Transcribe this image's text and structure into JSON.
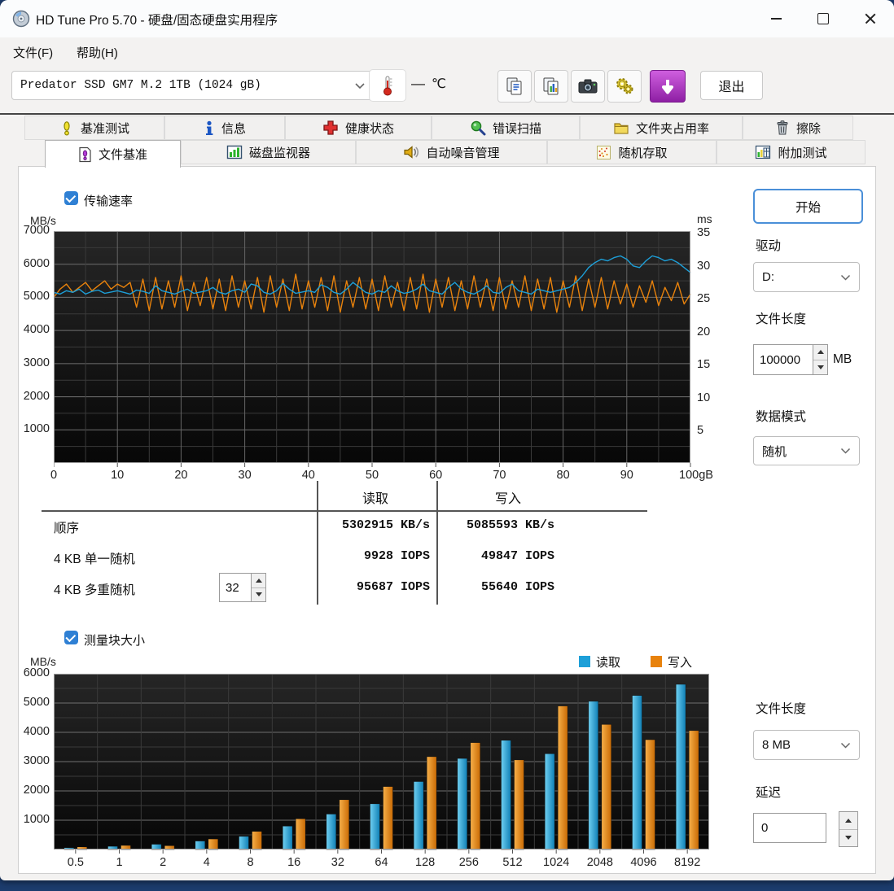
{
  "colors": {
    "accent": "#2f80d4",
    "read": "#1d9fd8",
    "write": "#e8820c",
    "desktop": "#1c3c6d"
  },
  "window": {
    "title": "HD Tune Pro 5.70 - 硬盘/固态硬盘实用程序"
  },
  "menu": {
    "items": [
      {
        "label": "文件(F)"
      },
      {
        "label": "帮助(H)"
      }
    ]
  },
  "toolbar": {
    "drive_select": "Predator SSD GM7 M.2 1TB (1024 gB)",
    "temp_dash": "—",
    "temp_unit": "℃",
    "exit_label": "退出"
  },
  "tabs": {
    "row1": [
      {
        "label": "基准测试"
      },
      {
        "label": "信息"
      },
      {
        "label": "健康状态"
      },
      {
        "label": "错误扫描"
      },
      {
        "label": "文件夹占用率"
      },
      {
        "label": "擦除"
      }
    ],
    "row2": [
      {
        "label": "文件基准"
      },
      {
        "label": "磁盘监视器"
      },
      {
        "label": "自动噪音管理"
      },
      {
        "label": "随机存取"
      },
      {
        "label": "附加测试"
      }
    ],
    "active": "文件基准"
  },
  "transfer_section": {
    "checkbox_label": "传输速率",
    "y_unit": "MB/s",
    "right_unit": "ms"
  },
  "results_table": {
    "col_headers": [
      "读取",
      "写入"
    ],
    "rows": [
      {
        "label": "顺序",
        "read": "5302915 KB/s",
        "write": "5085593 KB/s"
      },
      {
        "label": "4 KB 单一随机",
        "read": "9928 IOPS",
        "write": "49847 IOPS"
      },
      {
        "label": "4 KB 多重随机",
        "queue_depth": "32",
        "read": "95687 IOPS",
        "write": "55640 IOPS"
      }
    ]
  },
  "block_section": {
    "checkbox_label": "测量块大小",
    "y_unit": "MB/s",
    "legend": [
      {
        "label": "读取",
        "color": "#1d9fd8"
      },
      {
        "label": "写入",
        "color": "#e8820c"
      }
    ]
  },
  "controls_right": {
    "start": "开始",
    "drive_label": "驱动",
    "drive_value": "D:",
    "file_length_label": "文件长度",
    "file_length_value": "100000",
    "file_length_unit": "MB",
    "data_mode_label": "数据模式",
    "data_mode_value": "随机",
    "block_file_length_label": "文件长度",
    "block_file_length_value": "8 MB",
    "delay_label": "延迟",
    "delay_value": "0"
  },
  "chart_data": [
    {
      "type": "line",
      "title": "传输速率",
      "xlabel": "gB",
      "ylabel": "MB/s",
      "y2label": "ms",
      "xlim": [
        0,
        100
      ],
      "ylim": [
        0,
        7000
      ],
      "y2lim": [
        0,
        37
      ],
      "xticks": [
        "0",
        "10",
        "20",
        "30",
        "40",
        "50",
        "60",
        "70",
        "80",
        "90",
        "100gB"
      ],
      "yticks": [
        7000,
        6000,
        5000,
        4000,
        3000,
        2000,
        1000
      ],
      "y2ticks": [
        35,
        30,
        25,
        20,
        15,
        10,
        5
      ],
      "x_step": 1,
      "grid": true,
      "legend_position": "none",
      "series": [
        {
          "name": "读取",
          "color": "#1d9fd8",
          "values": [
            5150,
            5100,
            5200,
            5150,
            5250,
            5100,
            5180,
            5220,
            5120,
            5160,
            5200,
            5150,
            5100,
            5220,
            5180,
            5120,
            5350,
            5200,
            5150,
            5100,
            5180,
            5250,
            5120,
            5160,
            5200,
            5300,
            5150,
            5100,
            5200,
            5250,
            5150,
            5400,
            5350,
            5150,
            5100,
            5200,
            5420,
            5250,
            5120,
            5160,
            5200,
            5150,
            5380,
            5300,
            5150,
            5100,
            5250,
            5450,
            5300,
            5150,
            5100,
            5200,
            5150,
            5350,
            5200,
            5120,
            5160,
            5250,
            5400,
            5200,
            5150,
            5100,
            5300,
            5450,
            5250,
            5150,
            5100,
            5200,
            5350,
            5150,
            5120,
            5300,
            5400,
            5200,
            5150,
            5100,
            5250,
            5200,
            5150,
            5200,
            5250,
            5300,
            5450,
            5650,
            5900,
            6050,
            6150,
            6100,
            6200,
            6250,
            6150,
            5950,
            5900,
            6100,
            6250,
            6200,
            6100,
            6150,
            6050,
            5900,
            5750
          ]
        },
        {
          "name": "写入",
          "color": "#e8820c",
          "values": [
            5000,
            5250,
            5400,
            5150,
            5300,
            5450,
            5200,
            5350,
            5500,
            5250,
            5400,
            5300,
            5450,
            4700,
            5550,
            4600,
            5600,
            4650,
            5500,
            4700,
            5650,
            4600,
            5450,
            4750,
            5600,
            4650,
            5550,
            4600,
            5650,
            4700,
            5500,
            4650,
            5600,
            4550,
            5650,
            4700,
            5550,
            4600,
            5700,
            4650,
            5500,
            4700,
            5600,
            4600,
            5650,
            4550,
            5500,
            4700,
            5600,
            4650,
            5550,
            4600,
            5650,
            4700,
            5450,
            4600,
            5600,
            4650,
            5700,
            4550,
            5550,
            4700,
            5600,
            4600,
            5500,
            4650,
            5650,
            4700,
            5550,
            4600,
            5600,
            4650,
            5500,
            4700,
            5650,
            4600,
            5550,
            4650,
            5600,
            4550,
            5500,
            4700,
            5650,
            4600,
            5550,
            4700,
            5600,
            4650,
            5500,
            4800,
            5400,
            4700,
            5350,
            4850,
            5500,
            4750,
            5300,
            4900,
            5450,
            4800,
            5100
          ]
        }
      ]
    },
    {
      "type": "bar",
      "title": "测量块大小",
      "ylabel": "MB/s",
      "ylim": [
        0,
        6000
      ],
      "grid": true,
      "legend_position": "top-right",
      "yticks": [
        6000,
        5000,
        4000,
        3000,
        2000,
        1000
      ],
      "categories": [
        "0.5",
        "1",
        "2",
        "4",
        "8",
        "16",
        "32",
        "64",
        "128",
        "256",
        "512",
        "1024",
        "2048",
        "4096",
        "8192"
      ],
      "series": [
        {
          "name": "读取",
          "color": "#1d9fd8",
          "values": [
            60,
            110,
            180,
            290,
            450,
            800,
            1210,
            1560,
            2320,
            3110,
            3730,
            3270,
            5060,
            5260,
            5640
          ]
        },
        {
          "name": "写入",
          "color": "#e8820c",
          "values": [
            90,
            140,
            130,
            360,
            620,
            1050,
            1700,
            2150,
            3170,
            3650,
            3060,
            4900,
            4270,
            3750,
            4060
          ]
        }
      ]
    }
  ]
}
